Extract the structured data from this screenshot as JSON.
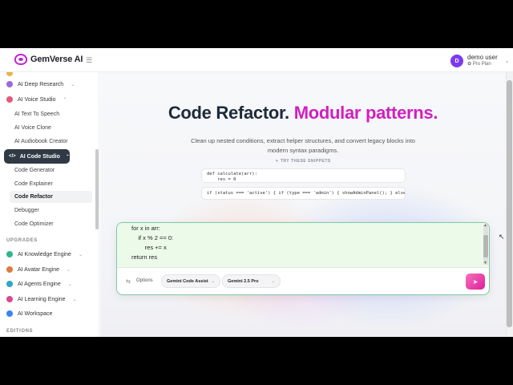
{
  "header": {
    "brand": "GemVerse AI",
    "menu_icon": "hamburger-icon",
    "user": {
      "initial": "D",
      "name": "demo user",
      "plan": "✿ Pro Plan"
    }
  },
  "sidebar": {
    "items": [
      {
        "label": "AI Deep Research",
        "icon": "research-icon",
        "color": "#9b6bd8"
      },
      {
        "label": "AI Voice Studio",
        "icon": "microphone-icon",
        "color": "#e05a7a"
      }
    ],
    "voice_children": [
      "AI Text To Speech",
      "AI Voice Clone",
      "AI Audiobook Creator"
    ],
    "active_section": "AI Code Studio",
    "code_children": [
      "Code Generator",
      "Code Explainer",
      "Code Refactor",
      "Debugger",
      "Code Optimizer"
    ],
    "active_child": "Code Refactor",
    "upgrades_label": "UPGRADES",
    "upgrades": [
      {
        "label": "AI Knowledge Engine",
        "color": "#2eb88a"
      },
      {
        "label": "AI Avatar Engine",
        "color": "#e07a40"
      },
      {
        "label": "AI Agents Engine",
        "color": "#2ea6c9"
      },
      {
        "label": "AI Learning Engine",
        "color": "#d94a8c"
      },
      {
        "label": "AI Workspace",
        "color": "#3b82f6"
      }
    ],
    "editions_label": "EDITIONS"
  },
  "main": {
    "title_primary": "Code Refactor.",
    "title_accent": "Modular patterns.",
    "accent_color": "#d11fbf",
    "subtitle": "Clean up nested conditions, extract helper structures, and convert legacy blocks into modern syntax paradigms.",
    "try_label": "✦ TRY THESE SNIPPETS",
    "snippets": [
      "def calculate(arr):\n    res = 0",
      "if (status === 'active') { if (type === 'admin') { showAdminPanel(); } else { showUse"
    ]
  },
  "composer": {
    "code_lines": [
      "for x in arr:",
      "    if x % 2 == 0:",
      "        res += x",
      "return res"
    ],
    "options_label": "Options",
    "assistant_select": "Gemini Code Assist",
    "model_select": "Gemini 2.5 Pro",
    "send_icon": "send-icon"
  }
}
